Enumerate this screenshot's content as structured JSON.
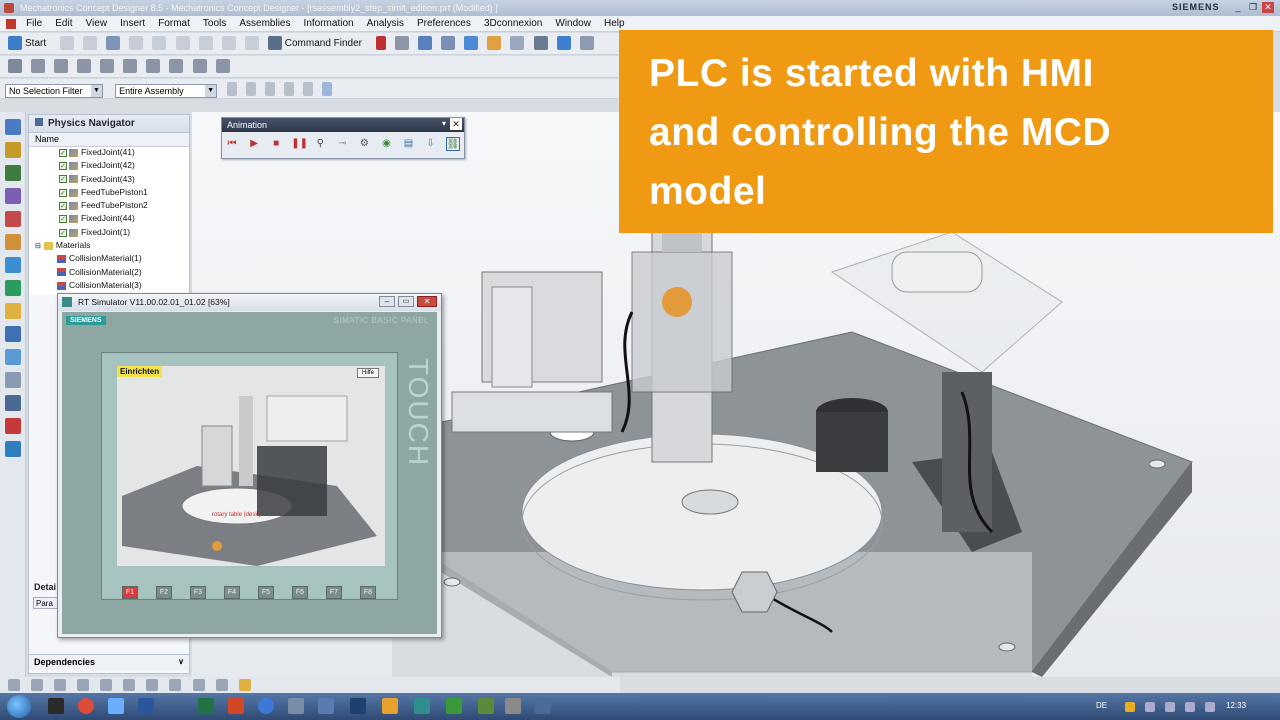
{
  "window": {
    "title": "Mechatronics Concept Designer 8.5 - Mechatronics Concept Designer - [rsassembly2_step_simit_edition.prt (Modified) ]",
    "brand": "SIEMENS",
    "controls": [
      "_",
      "❐",
      "✕"
    ]
  },
  "menu": {
    "items": [
      "File",
      "Edit",
      "View",
      "Insert",
      "Format",
      "Tools",
      "Assemblies",
      "Information",
      "Analysis",
      "Preferences",
      "3Dconnexion",
      "Window",
      "Help"
    ]
  },
  "toolbar": {
    "start_label": "Start",
    "command_finder_label": "Command Finder",
    "selection_filter": "No Selection Filter",
    "assembly_scope": "Entire Assembly"
  },
  "navigator": {
    "title": "Physics Navigator",
    "column_name": "Name",
    "rows": [
      {
        "label": "FixedJoint(41)",
        "type": "joint",
        "checked": true
      },
      {
        "label": "FixedJoint(42)",
        "type": "joint",
        "checked": true
      },
      {
        "label": "FixedJoint(43)",
        "type": "joint",
        "checked": true
      },
      {
        "label": "FeedTubePiston1",
        "type": "joint",
        "checked": true
      },
      {
        "label": "FeedTubePiston2",
        "type": "joint",
        "checked": true
      },
      {
        "label": "FixedJoint(44)",
        "type": "joint",
        "checked": true
      },
      {
        "label": "FixedJoint(1)",
        "type": "joint",
        "checked": true
      },
      {
        "label": "Materials",
        "type": "folder",
        "checked": false
      },
      {
        "label": "CollisionMaterial(1)",
        "type": "material",
        "checked": false
      },
      {
        "label": "CollisionMaterial(2)",
        "type": "material",
        "checked": false
      },
      {
        "label": "CollisionMaterial(3)",
        "type": "material",
        "checked": false
      }
    ],
    "details_label": "Detai",
    "params_label": "Para",
    "dependencies_label": "Dependencies"
  },
  "animation_toolbar": {
    "title": "Animation",
    "buttons": [
      "rewind-icon",
      "play-icon",
      "stop-icon",
      "pause-icon",
      "inspect-icon",
      "snapshot-icon",
      "settings-icon",
      "sensor-icon",
      "monitor-icon",
      "export-icon",
      "link-icon"
    ]
  },
  "banner": {
    "lines": [
      "PLC is started with HMI",
      "and controlling the MCD",
      "model"
    ]
  },
  "rt_simulator": {
    "title": "RT Simulator V11.00.02.01_01.02 [63%]",
    "brand": "SIEMENS",
    "panel_name": "SIMATIC BASIC PANEL",
    "touch_label": "TOUCH",
    "screen_title": "Einrichten",
    "help_button": "Hilfe",
    "model_label": "rotary table (desk)",
    "function_keys": [
      "F1",
      "F2",
      "F3",
      "F4",
      "F5",
      "F6",
      "F7",
      "F8"
    ],
    "active_key": "F1"
  },
  "taskbar": {
    "language": "DE",
    "clock": "12:33"
  },
  "colors": {
    "banner": "#f09a14",
    "panel": "#8fa7a3",
    "accent": "#2a9c97"
  }
}
